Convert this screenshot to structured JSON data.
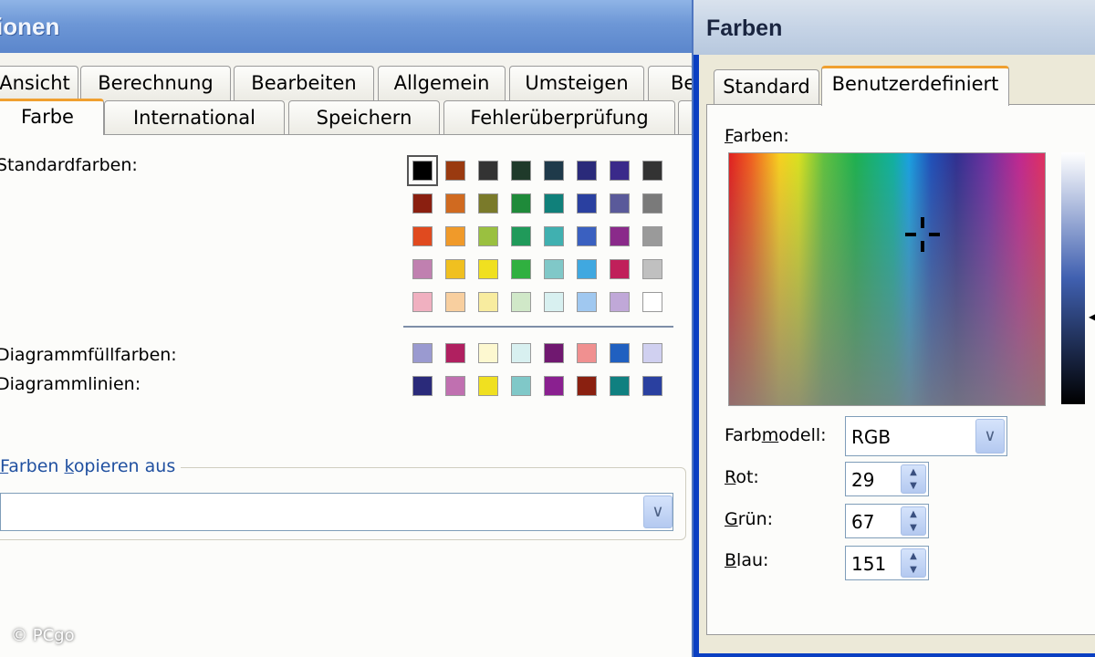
{
  "left_window": {
    "title": "ionen",
    "tabs_row1": [
      "Ansicht",
      "Berechnung",
      "Bearbeiten",
      "Allgemein",
      "Umsteigen",
      "Be"
    ],
    "tabs_row2": [
      "Farbe",
      "International",
      "Speichern",
      "Fehlerüberprüfung"
    ],
    "standard_label": "Standardfarben:",
    "chart_fill_label": "Diagrammfüllfarben:",
    "chart_lines_label": "Diagrammlinien:",
    "copy_group_label": "Farben kopieren aus",
    "copy_select_value": "",
    "standard_colors": [
      [
        "#000000",
        "#9a3a10",
        "#333333",
        "#1f3a2a",
        "#1f3a4a",
        "#2a2a7a",
        "#3a2a8a",
        "#333333"
      ],
      [
        "#8a1f10",
        "#d06a20",
        "#7a7a2a",
        "#1f8a3a",
        "#10807a",
        "#2a40a0",
        "#5a5a9a",
        "#7a7a7a"
      ],
      [
        "#e04a1f",
        "#f09a2a",
        "#9ac040",
        "#209a5a",
        "#40b0b0",
        "#3a60c0",
        "#8a2a8a",
        "#9a9a9a"
      ],
      [
        "#c080b0",
        "#f0c020",
        "#f0e020",
        "#30b040",
        "#80c8c8",
        "#40a8e0",
        "#c0205a",
        "#c0c0c0"
      ],
      [
        "#f0b0c0",
        "#f8cf9f",
        "#f8ec9f",
        "#d0e8c8",
        "#d8f0f0",
        "#a0c8f0",
        "#c0a8d8",
        "#ffffff"
      ]
    ],
    "chart_fill_colors": [
      "#9a9ad0",
      "#b02060",
      "#fdf8d0",
      "#d8f0f0",
      "#701870",
      "#f09090",
      "#2060c0",
      "#d0d0f0"
    ],
    "chart_line_colors": [
      "#2a2a7a",
      "#c070b0",
      "#f0e020",
      "#80c8c8",
      "#8a2090",
      "#8a2010",
      "#108080",
      "#2a40a0"
    ],
    "copyright": "© PCgo"
  },
  "right_window": {
    "title": "Farben",
    "tabs": [
      "Standard",
      "Benutzerdefiniert"
    ],
    "colors_label": "Farben:",
    "model_label": "Farbmodell:",
    "model_value": "RGB",
    "red_label": "Rot:",
    "green_label": "Grün:",
    "blue_label": "Blau:",
    "red_value": "29",
    "green_value": "67",
    "blue_value": "151"
  }
}
